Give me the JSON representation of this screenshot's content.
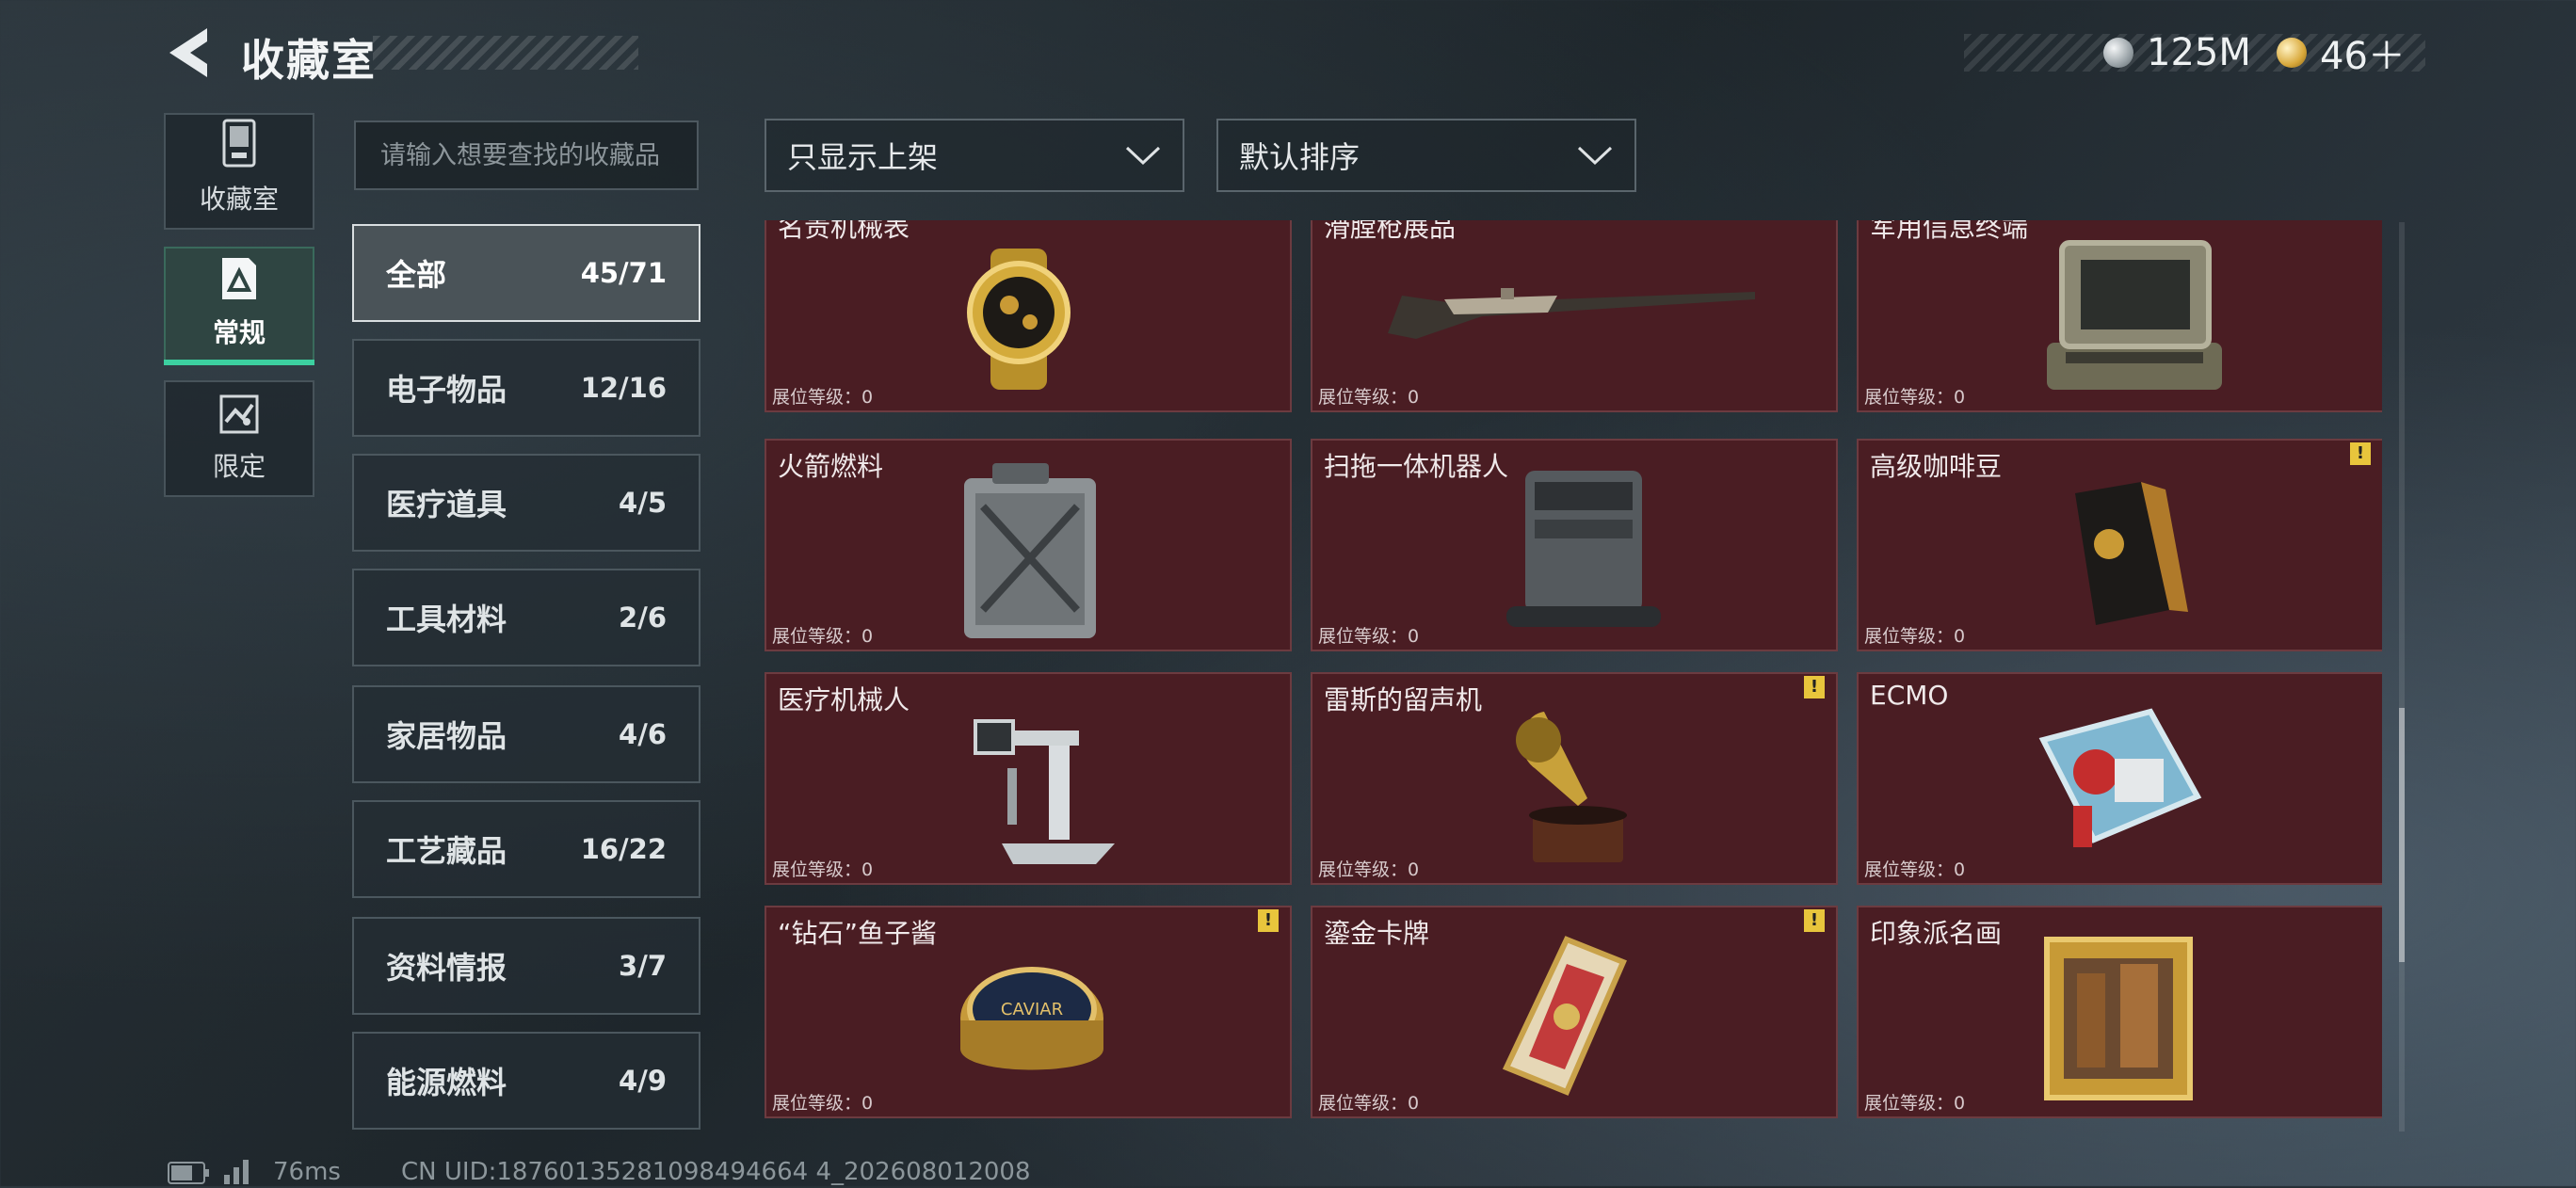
{
  "header": {
    "title": "收藏室",
    "currency": [
      {
        "icon": "silver-coin-icon",
        "value": "125M"
      },
      {
        "icon": "gold-coin-icon",
        "value": "46＋"
      }
    ]
  },
  "nav": [
    {
      "label": "收藏室",
      "icon": "vault-icon",
      "active": false
    },
    {
      "label": "常规",
      "icon": "document-icon",
      "active": true
    },
    {
      "label": "限定",
      "icon": "limited-icon",
      "active": false
    }
  ],
  "search": {
    "placeholder": "请输入想要查找的收藏品"
  },
  "filters": {
    "shelf": "只显示上架",
    "sort": "默认排序"
  },
  "categories": [
    {
      "label": "全部",
      "count": "45/71"
    },
    {
      "label": "电子物品",
      "count": "12/16"
    },
    {
      "label": "医疗道具",
      "count": "4/5"
    },
    {
      "label": "工具材料",
      "count": "2/6"
    },
    {
      "label": "家居物品",
      "count": "4/6"
    },
    {
      "label": "工艺藏品",
      "count": "16/22"
    },
    {
      "label": "资料情报",
      "count": "3/7"
    },
    {
      "label": "能源燃料",
      "count": "4/9"
    }
  ],
  "items": [
    {
      "name": "名贵机械表",
      "level": "展位等级：0",
      "warning": false,
      "icon": "watch-icon"
    },
    {
      "name": "滑膛枪展品",
      "level": "展位等级：0",
      "warning": false,
      "icon": "musket-icon"
    },
    {
      "name": "军用信息终端",
      "level": "展位等级：0",
      "warning": false,
      "icon": "terminal-icon"
    },
    {
      "name": "火箭燃料",
      "level": "展位等级：0",
      "warning": false,
      "icon": "fuel-can-icon"
    },
    {
      "name": "扫拖一体机器人",
      "level": "展位等级：0",
      "warning": false,
      "icon": "robot-vacuum-icon"
    },
    {
      "name": "高级咖啡豆",
      "level": "展位等级：0",
      "warning": true,
      "icon": "coffee-bag-icon"
    },
    {
      "name": "医疗机械人",
      "level": "展位等级：0",
      "warning": false,
      "icon": "medical-robot-icon"
    },
    {
      "name": "雷斯的留声机",
      "level": "展位等级：0",
      "warning": true,
      "icon": "gramophone-icon"
    },
    {
      "name": "ECMO",
      "level": "展位等级：0",
      "warning": false,
      "icon": "ecmo-icon"
    },
    {
      "name": "“钻石”鱼子酱",
      "level": "展位等级：0",
      "warning": true,
      "icon": "caviar-tin-icon",
      "art_text": "CAVIAR"
    },
    {
      "name": "鎏金卡牌",
      "level": "展位等级：0",
      "warning": true,
      "icon": "gold-card-icon"
    },
    {
      "name": "印象派名画",
      "level": "展位等级：0",
      "warning": false,
      "icon": "painting-icon"
    }
  ],
  "warning_symbol": "!",
  "footer": {
    "ping": "76ms",
    "uid": "CN UID:18760135281098494664 4_202608012008"
  }
}
